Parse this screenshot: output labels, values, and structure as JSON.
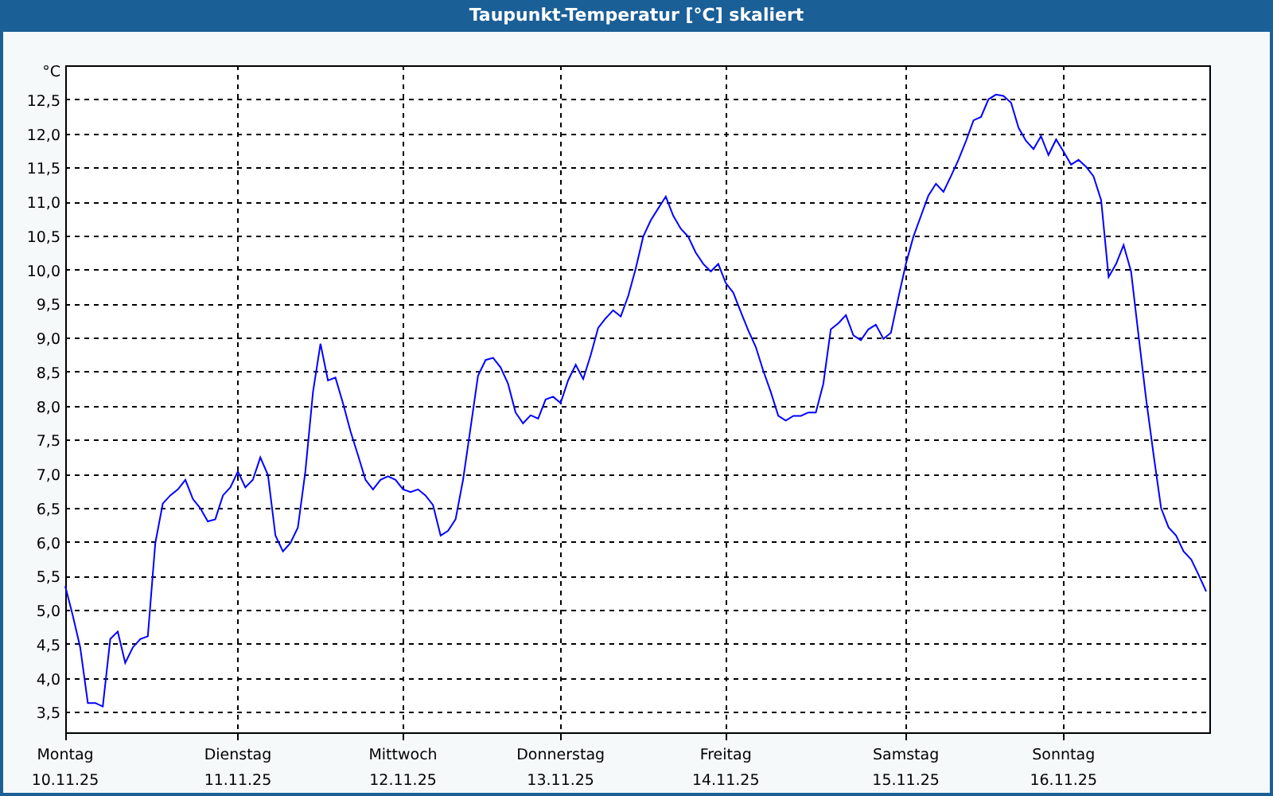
{
  "window": {
    "title": "Taupunkt-Temperatur [°C] skaliert"
  },
  "chart": {
    "chart_data": {
      "type": "line",
      "grid": true,
      "ylabel": "°C",
      "ylim": [
        3.2,
        13.0
      ],
      "yticks": [
        {
          "value": 3.5,
          "label": "3,5"
        },
        {
          "value": 4,
          "label": "4,0"
        },
        {
          "value": 4.5,
          "label": "4,5"
        },
        {
          "value": 5,
          "label": "5,0"
        },
        {
          "value": 5.5,
          "label": "5,5"
        },
        {
          "value": 6,
          "label": "6,0"
        },
        {
          "value": 6.5,
          "label": "6,5"
        },
        {
          "value": 7,
          "label": "7,0"
        },
        {
          "value": 7.5,
          "label": "7,5"
        },
        {
          "value": 8,
          "label": "8,0"
        },
        {
          "value": 8.5,
          "label": "8,5"
        },
        {
          "value": 9,
          "label": "9,0"
        },
        {
          "value": 9.5,
          "label": "9,5"
        },
        {
          "value": 10,
          "label": "10,0"
        },
        {
          "value": 10.5,
          "label": "10,5"
        },
        {
          "value": 11,
          "label": "11,0"
        },
        {
          "value": 11.5,
          "label": "11,5"
        },
        {
          "value": 12,
          "label": "12,0"
        },
        {
          "value": 12.5,
          "label": "12,5"
        }
      ],
      "categories": [
        "Montag 10.11.25",
        null,
        null,
        null,
        null,
        null,
        null,
        null,
        null,
        null,
        null,
        null,
        null,
        null,
        null,
        null,
        null,
        null,
        null,
        null,
        null,
        null,
        null,
        "Dienstag 11.11.25",
        null,
        null,
        null,
        null,
        null,
        null,
        null,
        null,
        null,
        null,
        null,
        null,
        null,
        null,
        null,
        null,
        null,
        null,
        null,
        null,
        null,
        "Mittwoch 12.11.25",
        null,
        null,
        null,
        null,
        null,
        null,
        null,
        null,
        null,
        null,
        null,
        null,
        null,
        null,
        null,
        null,
        null,
        null,
        null,
        null,
        "Donnerstag 13.11.25",
        null,
        null,
        null,
        null,
        null,
        null,
        null,
        null,
        null,
        null,
        null,
        null,
        null,
        null,
        null,
        null,
        null,
        null,
        null,
        null,
        null,
        "Freitag 14.11.25",
        null,
        null,
        null,
        null,
        null,
        null,
        null,
        null,
        null,
        null,
        null,
        null,
        null,
        null,
        null,
        null,
        null,
        null,
        null,
        null,
        null,
        null,
        null,
        "Samstag 15.11.25",
        null,
        null,
        null,
        null,
        null,
        null,
        null,
        null,
        null,
        null,
        null,
        null,
        null,
        null,
        null,
        null,
        null,
        null,
        null,
        null,
        "Sonntag 16.11.25",
        null,
        null,
        null,
        null,
        null,
        null,
        null,
        null,
        null,
        null,
        null,
        null,
        null,
        null,
        null,
        null,
        null,
        null,
        null
      ],
      "series": [
        {
          "color": "#0000ff",
          "values": [
            5.35,
            4.92,
            4.45,
            3.63,
            3.63,
            3.58,
            4.57,
            4.68,
            4.22,
            4.45,
            4.57,
            4.61,
            5.98,
            6.56,
            6.68,
            6.77,
            6.91,
            6.63,
            6.49,
            6.3,
            6.33,
            6.68,
            6.8,
            7.03,
            6.8,
            6.91,
            7.24,
            6.98,
            6.09,
            5.86,
            5.98,
            6.21,
            7.03,
            8.2,
            8.91,
            8.37,
            8.41,
            8.04,
            7.62,
            7.27,
            6.91,
            6.77,
            6.91,
            6.96,
            6.91,
            6.77,
            6.73,
            6.77,
            6.68,
            6.54,
            6.09,
            6.16,
            6.33,
            6.91,
            7.67,
            8.44,
            8.67,
            8.7,
            8.56,
            8.32,
            7.9,
            7.74,
            7.86,
            7.81,
            8.09,
            8.13,
            8.04,
            8.37,
            8.6,
            8.39,
            8.74,
            9.14,
            9.28,
            9.4,
            9.31,
            9.61,
            10.01,
            10.48,
            10.72,
            10.9,
            11.07,
            10.79,
            10.6,
            10.48,
            10.25,
            10.08,
            9.97,
            10.08,
            9.8,
            9.66,
            9.38,
            9.1,
            8.86,
            8.51,
            8.2,
            7.85,
            7.78,
            7.85,
            7.85,
            7.9,
            7.9,
            8.32,
            9.12,
            9.21,
            9.33,
            9.03,
            8.96,
            9.12,
            9.19,
            8.98,
            9.07,
            9.59,
            10.08,
            10.48,
            10.79,
            11.09,
            11.26,
            11.14,
            11.37,
            11.61,
            11.89,
            12.19,
            12.24,
            12.5,
            12.57,
            12.55,
            12.45,
            12.08,
            11.89,
            11.77,
            11.96,
            11.68,
            11.91,
            11.73,
            11.54,
            11.61,
            11.51,
            11.37,
            11.02,
            9.89,
            10.08,
            10.36,
            9.97,
            9.03,
            8.09,
            7.27,
            6.49,
            6.21,
            6.09,
            5.86,
            5.74,
            5.51,
            5.27
          ]
        }
      ]
    }
  }
}
